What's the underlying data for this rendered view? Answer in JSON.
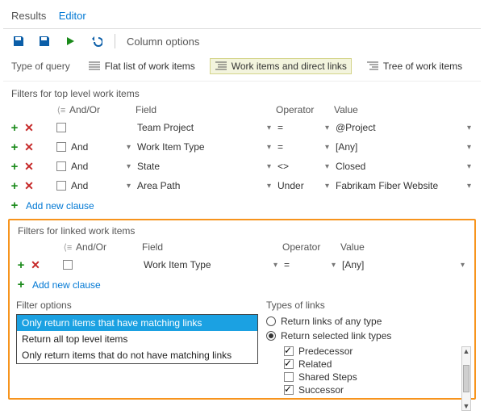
{
  "tabs": {
    "results": "Results",
    "editor": "Editor",
    "active": "editor"
  },
  "toolbar": {
    "column_options": "Column options"
  },
  "query_type": {
    "label": "Type of query",
    "flat": "Flat list of work items",
    "direct": "Work items and direct links",
    "tree": "Tree of work items",
    "selected": "direct"
  },
  "top": {
    "title": "Filters for top level work items",
    "headers": {
      "andor": "And/Or",
      "field": "Field",
      "operator": "Operator",
      "value": "Value"
    },
    "rows": [
      {
        "andor": "",
        "field": "Team Project",
        "op": "=",
        "value": "@Project"
      },
      {
        "andor": "And",
        "field": "Work Item Type",
        "op": "=",
        "value": "[Any]"
      },
      {
        "andor": "And",
        "field": "State",
        "op": "<>",
        "value": "Closed"
      },
      {
        "andor": "And",
        "field": "Area Path",
        "op": "Under",
        "value": "Fabrikam Fiber Website"
      }
    ],
    "add_clause": "Add new clause"
  },
  "linked": {
    "title": "Filters for linked work items",
    "headers": {
      "andor": "And/Or",
      "field": "Field",
      "operator": "Operator",
      "value": "Value"
    },
    "rows": [
      {
        "andor": "",
        "field": "Work Item Type",
        "op": "=",
        "value": "[Any]"
      }
    ],
    "add_clause": "Add new clause",
    "filter_options": {
      "title": "Filter options",
      "items": [
        "Only return items that have matching links",
        "Return all top level items",
        "Only return items that do not have matching links"
      ],
      "selected": 0
    },
    "link_types": {
      "title": "Types of links",
      "radio_any": "Return links of any type",
      "radio_selected": "Return selected link types",
      "radio_value": "selected",
      "items": [
        {
          "label": "Predecessor",
          "checked": true
        },
        {
          "label": "Related",
          "checked": true
        },
        {
          "label": "Shared Steps",
          "checked": false
        },
        {
          "label": "Successor",
          "checked": true
        }
      ]
    }
  }
}
